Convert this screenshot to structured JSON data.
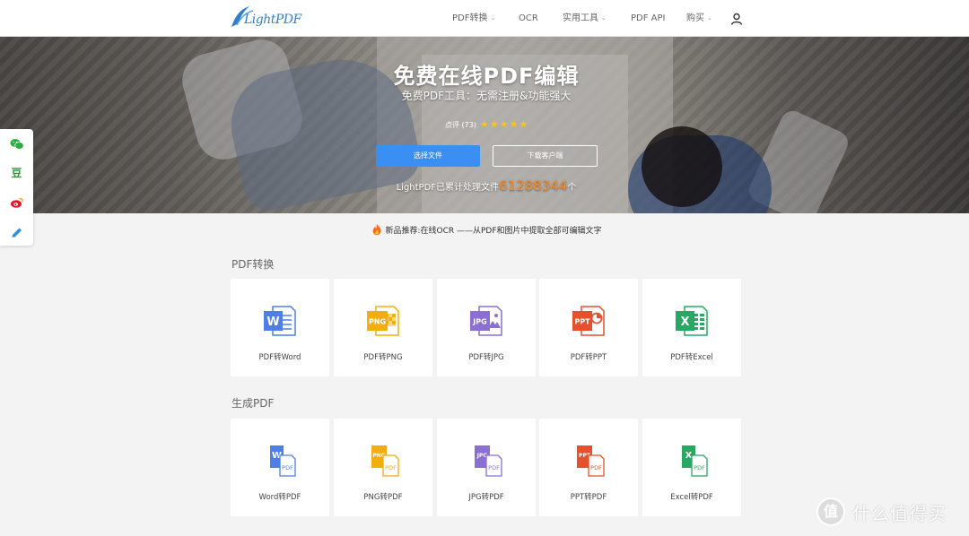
{
  "header": {
    "logo_text": "LightPDF",
    "nav": [
      {
        "label": "PDF转换",
        "has_chevron": true
      },
      {
        "label": "OCR",
        "has_chevron": false
      },
      {
        "label": "实用工具",
        "has_chevron": true
      },
      {
        "label": "PDF API",
        "has_chevron": false
      },
      {
        "label": "购买",
        "has_chevron": true
      }
    ],
    "user_icon": "user-icon"
  },
  "hero": {
    "title": "免费在线PDF编辑",
    "subtitle": "免费PDF工具：无需注册&功能强大",
    "rating_label": "点评 (73)",
    "stars": 5,
    "select_file_button": "选择文件",
    "download_client_button": "下载客户端",
    "counter_prefix": "LightPDF已累计处理文件",
    "counter_value": "61288344",
    "counter_suffix": "个"
  },
  "social": [
    "wechat-icon",
    "douban-icon",
    "weibo-icon",
    "pencil-icon"
  ],
  "social_douban_glyph": "豆",
  "announcement": {
    "icon": "flame-icon",
    "text": "新品推荐:在线OCR ——从PDF和图片中提取全部可编辑文字"
  },
  "sections": [
    {
      "title": "PDF转换",
      "cards": [
        {
          "label": "PDF转Word",
          "icon": "word-icon",
          "color": "#4d7fe6",
          "badge": "W"
        },
        {
          "label": "PDF转PNG",
          "icon": "png-icon",
          "color": "#f2ad0f",
          "badge": "PNG"
        },
        {
          "label": "PDF转JPG",
          "icon": "jpg-icon",
          "color": "#8b6fd3",
          "badge": "JPG"
        },
        {
          "label": "PDF转PPT",
          "icon": "ppt-icon",
          "color": "#e5512d",
          "badge": "PPT"
        },
        {
          "label": "PDF转Excel",
          "icon": "excel-icon",
          "color": "#28a862",
          "badge": "X"
        }
      ]
    },
    {
      "title": "生成PDF",
      "cards": [
        {
          "label": "Word转PDF",
          "icon": "word-to-pdf-icon",
          "color": "#4d7fe6",
          "badge": "W"
        },
        {
          "label": "PNG转PDF",
          "icon": "png-to-pdf-icon",
          "color": "#f2ad0f",
          "badge": "PNG"
        },
        {
          "label": "JPG转PDF",
          "icon": "jpg-to-pdf-icon",
          "color": "#8b6fd3",
          "badge": "JPG"
        },
        {
          "label": "PPT转PDF",
          "icon": "ppt-to-pdf-icon",
          "color": "#e5512d",
          "badge": "PPT"
        },
        {
          "label": "Excel转PDF",
          "icon": "excel-to-pdf-icon",
          "color": "#28a862",
          "badge": "X"
        }
      ]
    }
  ],
  "pdf_badge": "PDF",
  "watermark": {
    "glyph": "值",
    "text": "什么值得买"
  },
  "colors": {
    "accent": "#3b8ff3",
    "counter": "#ff8a1e",
    "star": "#ffc21a"
  }
}
